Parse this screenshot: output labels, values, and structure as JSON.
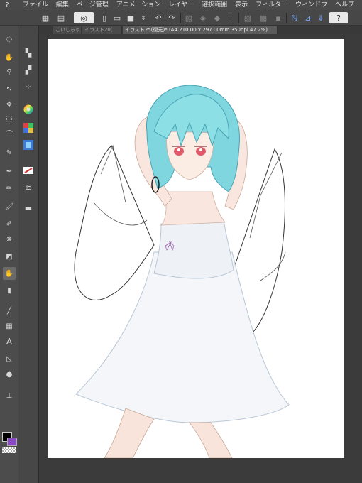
{
  "menu": {
    "items": [
      "ファイル",
      "編集",
      "ページ管理",
      "アニメーション",
      "レイヤー",
      "選択範囲",
      "表示",
      "フィルター",
      "ウィンドウ",
      "ヘルプ"
    ]
  },
  "toolbar": {
    "help_label": "?"
  },
  "tabs": [
    "こいしちゃん",
    "イラスト20(",
    "イラスト25(復元)* (A4 210.00 x 297.00mm 350dpi 47.2%)"
  ],
  "colors": {
    "main_color": "#000000",
    "sub_color": "#8a49c0",
    "accent_blue": "#6fa7ff",
    "hair": "#7fd6de",
    "eyes": "#e05a6a"
  },
  "artwork": {
    "subject": "illustration",
    "hair_color": "#7fd6de"
  }
}
